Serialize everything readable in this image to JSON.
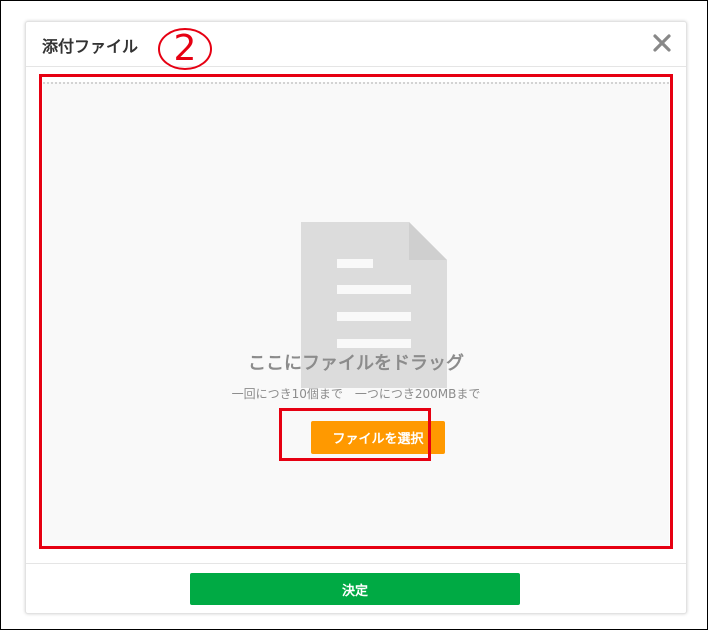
{
  "dialog": {
    "title": "添付ファイル",
    "step_number": "2",
    "close_icon": "close-icon"
  },
  "dropzone": {
    "icon": "document-icon",
    "title": "ここにファイルをドラッグ",
    "limits": "一回につき10個まで　一つにつき200MBまで",
    "select_button": "ファイルを選択"
  },
  "footer": {
    "confirm_button": "決定"
  },
  "colors": {
    "select_button": "#ff9900",
    "confirm_button": "#00aa44",
    "annotation_red": "#e60012",
    "icon_gray": "#dcdcdc"
  }
}
